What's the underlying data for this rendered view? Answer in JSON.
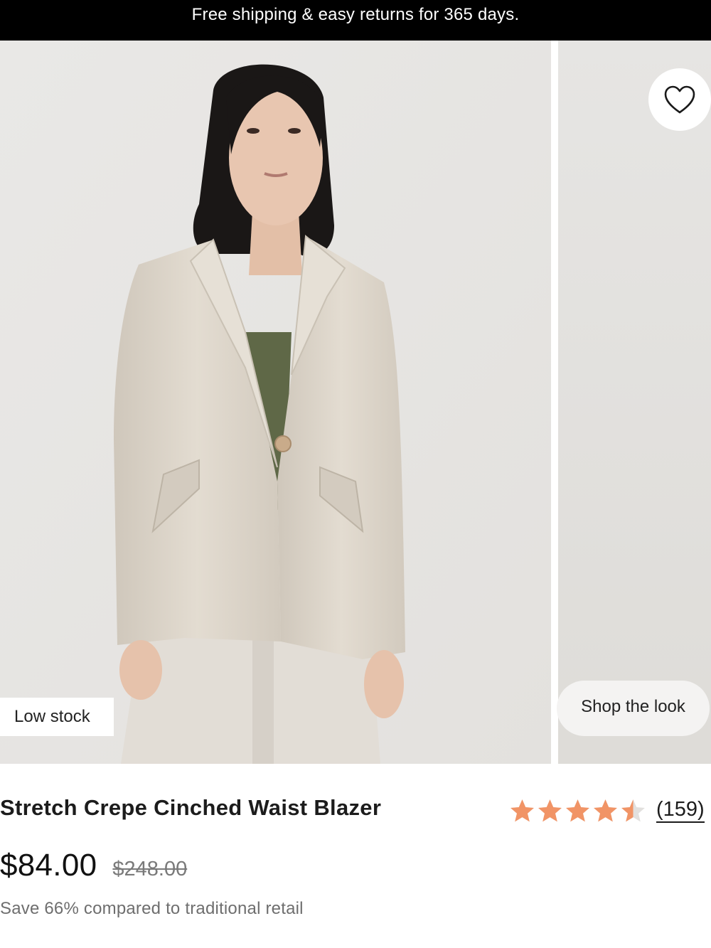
{
  "promo": {
    "text": "Free shipping & easy returns for 365 days."
  },
  "gallery": {
    "badge": "Low stock",
    "shop_the_look": "Shop the look",
    "favorite_icon": "heart-outline-icon"
  },
  "product": {
    "title": "Stretch Crepe Cinched Waist Blazer",
    "rating": {
      "value": 4.5,
      "max": 5,
      "review_count": "(159)",
      "star_color": "#f19466",
      "star_empty_color": "#e2e0de"
    },
    "price": {
      "current": "$84.00",
      "original": "$248.00"
    },
    "savings": "Save 66% compared to traditional retail"
  },
  "colors": {
    "promo_bg": "#000000",
    "blazer": "#dcd4c9",
    "top": "#5f6847",
    "hair": "#1a1716",
    "skin": "#e8c6b0"
  }
}
